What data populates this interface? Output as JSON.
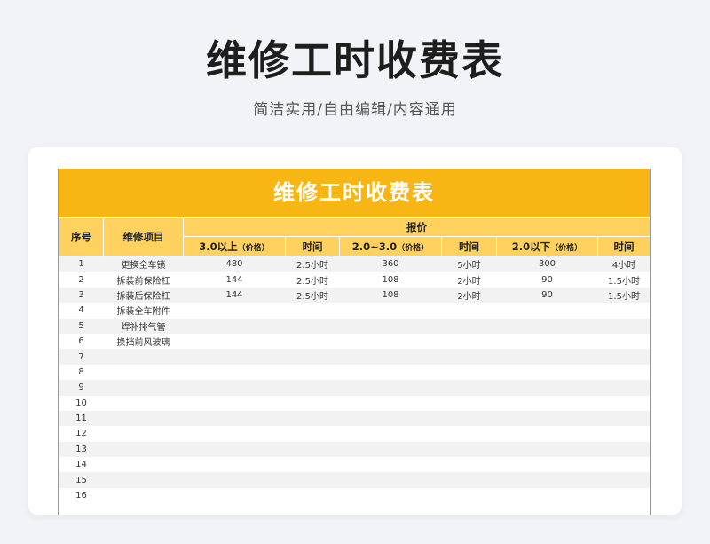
{
  "page": {
    "title": "维修工时收费表",
    "subtitle": "简洁实用/自由编辑/内容通用"
  },
  "sheet": {
    "banner": "维修工时收费表",
    "headers": {
      "seq": "序号",
      "item": "维修项目",
      "price": "报价",
      "groups": [
        {
          "label": "3.0以上",
          "unit": "（价格）",
          "time": "时间"
        },
        {
          "label": "2.0~3.0",
          "unit": "（价格）",
          "time": "时间"
        },
        {
          "label": "2.0以下",
          "unit": "（价格）",
          "time": "时间"
        }
      ]
    },
    "rows": [
      [
        "1",
        "更换全车锁",
        "480",
        "2.5小时",
        "360",
        "5小时",
        "300",
        "4小时"
      ],
      [
        "2",
        "拆装前保险杠",
        "144",
        "2.5小时",
        "108",
        "2小时",
        "90",
        "1.5小时"
      ],
      [
        "3",
        "拆装后保险杠",
        "144",
        "2.5小时",
        "108",
        "2小时",
        "90",
        "1.5小时"
      ],
      [
        "4",
        "拆装全车附件",
        "",
        "",
        "",
        "",
        "",
        ""
      ],
      [
        "5",
        "焊补排气管",
        "",
        "",
        "",
        "",
        "",
        ""
      ],
      [
        "6",
        "换挡前风玻璃",
        "",
        "",
        "",
        "",
        "",
        ""
      ],
      [
        "7",
        "",
        "",
        "",
        "",
        "",
        "",
        ""
      ],
      [
        "8",
        "",
        "",
        "",
        "",
        "",
        "",
        ""
      ],
      [
        "9",
        "",
        "",
        "",
        "",
        "",
        "",
        ""
      ],
      [
        "10",
        "",
        "",
        "",
        "",
        "",
        "",
        ""
      ],
      [
        "11",
        "",
        "",
        "",
        "",
        "",
        "",
        ""
      ],
      [
        "12",
        "",
        "",
        "",
        "",
        "",
        "",
        ""
      ],
      [
        "13",
        "",
        "",
        "",
        "",
        "",
        "",
        ""
      ],
      [
        "14",
        "",
        "",
        "",
        "",
        "",
        "",
        ""
      ],
      [
        "15",
        "",
        "",
        "",
        "",
        "",
        "",
        ""
      ],
      [
        "16",
        "",
        "",
        "",
        "",
        "",
        "",
        ""
      ]
    ]
  },
  "colors": {
    "banner": "#f7b614",
    "header": "#ffd260",
    "stripe": "#f2f2f2",
    "background": "#f1f3f6"
  }
}
